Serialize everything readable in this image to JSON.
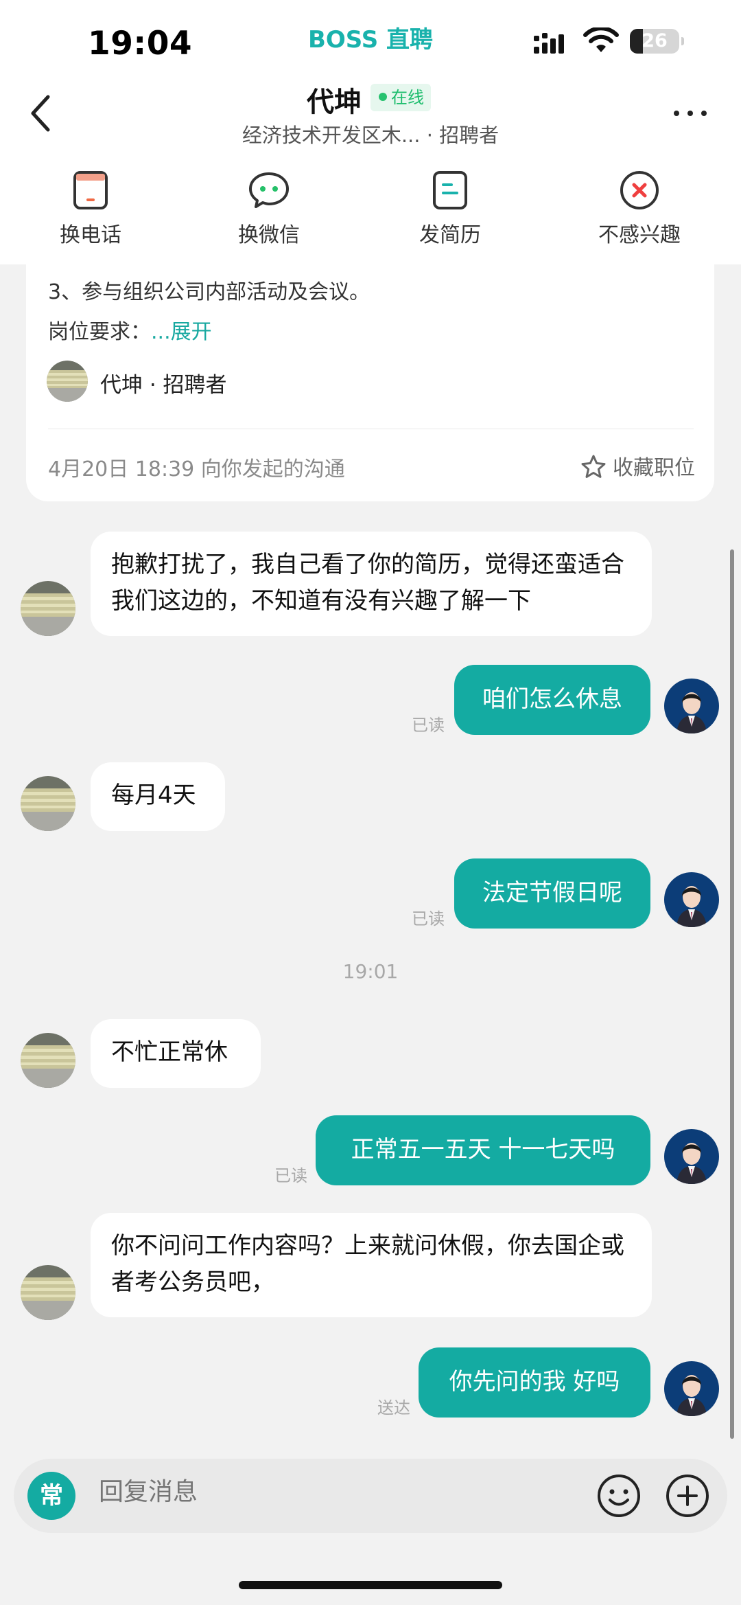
{
  "status_bar": {
    "time": "19:04",
    "app_name": "BOSS 直聘",
    "battery": "26",
    "battery_fraction": 0.26
  },
  "header": {
    "name": "代坤",
    "online_label": "在线",
    "subtitle": "经济技术开发区木... · 招聘者"
  },
  "actions": [
    {
      "label": "换电话",
      "icon": "phone-card-icon"
    },
    {
      "label": "换微信",
      "icon": "wechat-icon"
    },
    {
      "label": "发简历",
      "icon": "resume-icon"
    },
    {
      "label": "不感兴趣",
      "icon": "not-interested-icon"
    }
  ],
  "job_card": {
    "line1": "3、参与组织公司内部活动及会议。",
    "requirement_label": "岗位要求：",
    "expand_label": "...展开",
    "recruiter_line": "代坤 · 招聘者",
    "initiated": "4月20日 18:39 向你发起的沟通",
    "favorite_label": "收藏职位"
  },
  "messages": [
    {
      "from": "recruiter",
      "text": "抱歉打扰了，我自己看了你的简历，觉得还蛮适合我们这边的，不知道有没有兴趣了解一下"
    },
    {
      "from": "me",
      "text": "咱们怎么休息",
      "status": "已读"
    },
    {
      "from": "recruiter",
      "text": "每月4天"
    },
    {
      "from": "me",
      "text": "法定节假日呢",
      "status": "已读"
    },
    {
      "from": "recruiter",
      "text": "不忙正常休"
    },
    {
      "from": "me",
      "text": "正常五一五天 十一七天吗",
      "status": "已读"
    },
    {
      "from": "recruiter",
      "text": "你不问问工作内容吗？上来就问休假，你去国企或者考公务员吧，"
    },
    {
      "from": "me",
      "text": "你先问的我 好吗",
      "status": "送达"
    }
  ],
  "timestamp_divider": "19:01",
  "input": {
    "quick_label": "常",
    "placeholder": "回复消息"
  },
  "colors": {
    "accent": "#14aba2",
    "brand": "#19b2ac",
    "online": "#1dbd6d",
    "background": "#f2f2f2"
  }
}
